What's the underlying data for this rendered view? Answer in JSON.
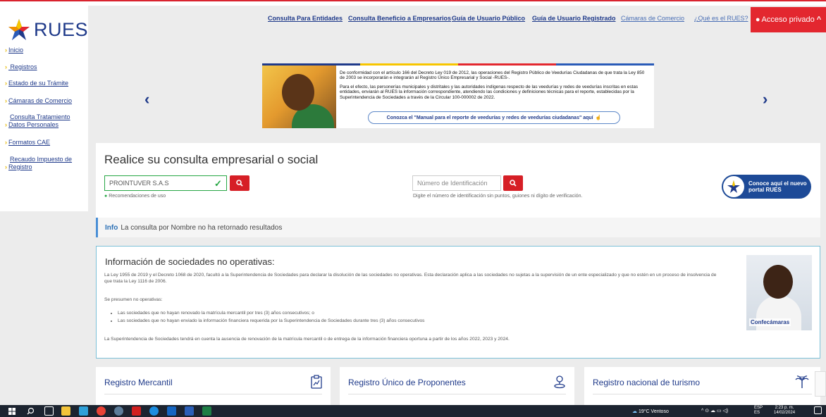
{
  "logo": {
    "text": "RUES"
  },
  "sidebar": {
    "items": [
      {
        "label": "Inicio"
      },
      {
        "label": "Registros"
      },
      {
        "label": "Estado de su Trámite"
      },
      {
        "label": "Cámaras de Comercio"
      },
      {
        "label_line1": "Consulta Tratamiento",
        "label_line2": "Datos Personales"
      },
      {
        "label": "Formatos CAE"
      },
      {
        "label_line1": "Recaudo Impuesto de",
        "label_line2": "Registro"
      }
    ]
  },
  "top_nav": {
    "links": [
      "Consulta Para Entidades",
      "Consulta Beneficio a Empresarios",
      "Guía de Usuario Público",
      "Guía de Usuario Registrado",
      "Cámaras de Comercio",
      "¿Qué es el RUES?"
    ],
    "access_label": "Acceso privado"
  },
  "banner": {
    "para1": "De conformidad con el artículo 166 del Decreto Ley 019 de 2012, las operaciones del Registro Público de Veedurías Ciudadanas de que trata la Ley 850 de 2003 se incorporarán e integrarán al Registro Único Empresarial y Social -RUES-.",
    "para2": "Para el efecto, las personerías municipales y distritales y las autoridades indígenas respecto de las veedurías y redes de veedurías inscritas en estas entidades, enviarán al RUES la información correspondiente, atendiendo las condiciones y definiciones técnicas para el reporte, establecidas por la Superintendencia de Sociedades a través de la Circular 100-000002 de 2022.",
    "button": "Conozca el \"Manual para el reporte de veedurías y redes de veedurías ciudadanas\" aquí"
  },
  "search": {
    "title": "Realice su consulta empresarial o social",
    "name_value": "PROINTUVER S.A.S",
    "name_hint": "Recomendaciones de uso",
    "id_placeholder": "Número de Identificación",
    "id_hint": "Digite el número de identificación sin puntos, guiones ni dígito de verificación.",
    "portal_line1": "Conoce aquí el nuevo",
    "portal_line2": "portal RUES"
  },
  "info": {
    "label": "Info",
    "message": "La consulta por Nombre no ha retornado resultados"
  },
  "sociedades": {
    "title": "Información de sociedades no operativas:",
    "para1": "La Ley 1955 de 2019 y el Decreto 1068 de 2020, facultó a la Superintendencia de Sociedades para declarar la disolución de las sociedades no operativas. Esta declaración aplica a las sociedades no sujetas a la supervisión de un ente especializado y que no estén en un proceso de insolvencia de que trata la Ley 1116 de 2006.",
    "para2": "Se presumen no operativas:",
    "bullets": [
      "Las sociedades que no hayan renovado la matrícula mercantil por tres (3) años consecutivos; o",
      "Las sociedades que no hayan enviado la información financiera requerida por la Superintendencia de Sociedades durante tres (3) años consecutivos"
    ],
    "para3": "La Superintendencia de Sociedades tendrá en cuenta la ausencia de renovación de la matrícula mercantil o de entrega de la información financiera oportuna a partir de los años 2022, 2023 y 2024.",
    "image_logo": "Confecámaras"
  },
  "cards": [
    {
      "title": "Registro Mercantil"
    },
    {
      "title": "Registro Único de Proponentes"
    },
    {
      "title": "Registro nacional de turismo"
    }
  ],
  "taskbar": {
    "weather": "19°C Ventoso",
    "lang1": "ESP",
    "lang2": "ES",
    "time": "2:23 p. m.",
    "date": "14/02/2024"
  }
}
